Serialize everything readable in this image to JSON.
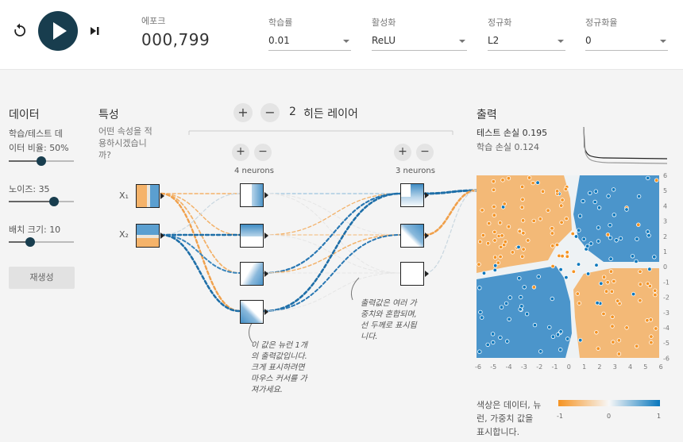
{
  "controls": {
    "reset_icon": "reset-icon",
    "play_icon": "play-icon",
    "step_icon": "step-icon"
  },
  "header": {
    "epoch_label": "에포크",
    "epoch_value": "000,799",
    "learning_rate_label": "학습률",
    "learning_rate_value": "0.01",
    "activation_label": "활성화",
    "activation_value": "ReLU",
    "regularization_label": "정규화",
    "regularization_value": "L2",
    "reg_rate_label": "정규화율",
    "reg_rate_value": "0"
  },
  "data_panel": {
    "title": "데이터",
    "ratio_label_1": "학습/테스트 데",
    "ratio_label_2": "이터 비율: ",
    "ratio_value": "50%",
    "ratio_fraction": 0.5,
    "noise_label": "노이즈: ",
    "noise_value": "35",
    "noise_fraction": 0.7,
    "batch_label": "배치 크기: ",
    "batch_value": "10",
    "batch_fraction": 0.33,
    "regenerate_label": "재생성"
  },
  "features": {
    "title": "특성",
    "question_1": "어떤 속성을 적",
    "question_2": "용하시겠습니",
    "question_3": "까?",
    "x1_label": "X₁",
    "x2_label": "X₂"
  },
  "hidden": {
    "plus": "+",
    "minus": "−",
    "count": "2",
    "label": "히든 레이어",
    "layer1_neurons": "4 neurons",
    "layer2_neurons": "3 neurons"
  },
  "notes": {
    "neuron_note": [
      "이 값은 뉴런 1개",
      "의 출력값입니다.",
      "크게 표시하려면",
      "마우스 커서를 가",
      "져가세요."
    ],
    "weights_note": [
      "출력값은 여러 가",
      "중치와 혼합되며,",
      "선 두께로 표시됩",
      "니다."
    ]
  },
  "output": {
    "title": "출력",
    "test_loss_label": "테스트 손실 ",
    "test_loss_value": "0.195",
    "train_loss_label": "학습 손실 ",
    "train_loss_value": "0.124",
    "axis_ticks_x": [
      "-6",
      "-5",
      "-4",
      "-3",
      "-2",
      "-1",
      "0",
      "1",
      "2",
      "3",
      "4",
      "5",
      "6"
    ],
    "axis_ticks_y": [
      "6",
      "5",
      "4",
      "3",
      "2",
      "1",
      "0",
      "-1",
      "-2",
      "-3",
      "-4",
      "-5",
      "-6"
    ],
    "legend_text": [
      "색상은 데이터, 뉴",
      "런, 가중치 값을",
      "표시합니다."
    ],
    "legend_ticks": [
      "-1",
      "0",
      "1"
    ],
    "color_orange": "#f59322",
    "color_blue": "#0877bd"
  }
}
